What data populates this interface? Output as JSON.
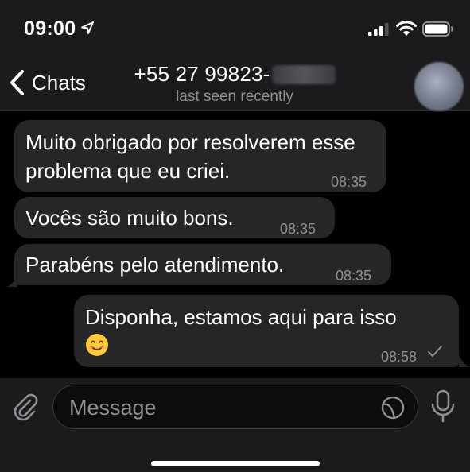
{
  "status_bar": {
    "time": "09:00",
    "icons": [
      "location-arrow-icon",
      "signal-bars-icon",
      "wifi-icon",
      "battery-icon"
    ]
  },
  "nav": {
    "back_label": "Chats",
    "contact_name": "+55 27 99823-",
    "contact_status": "last seen recently",
    "icons": [
      "chevron-left-icon",
      "avatar"
    ]
  },
  "messages": [
    {
      "direction": "incoming",
      "text": "Muito obrigado por resolverem esse problema que eu criei.",
      "time": "08:35"
    },
    {
      "direction": "incoming",
      "text": "Vocês são muito bons.",
      "time": "08:35"
    },
    {
      "direction": "incoming",
      "text": "Parabéns pelo atendimento.",
      "time": "08:35"
    },
    {
      "direction": "outgoing",
      "text": "Disponha, estamos aqui para isso",
      "emoji": "smiling-face-emoji",
      "time": "08:58",
      "status": "check-icon"
    }
  ],
  "composer": {
    "placeholder": "Message",
    "icons": [
      "paperclip-icon",
      "sticker-icon",
      "microphone-icon"
    ]
  },
  "colors": {
    "background": "#000000",
    "bar": "#1b1b1d",
    "bubble": "#262628",
    "secondary_text": "#8e8e93"
  }
}
